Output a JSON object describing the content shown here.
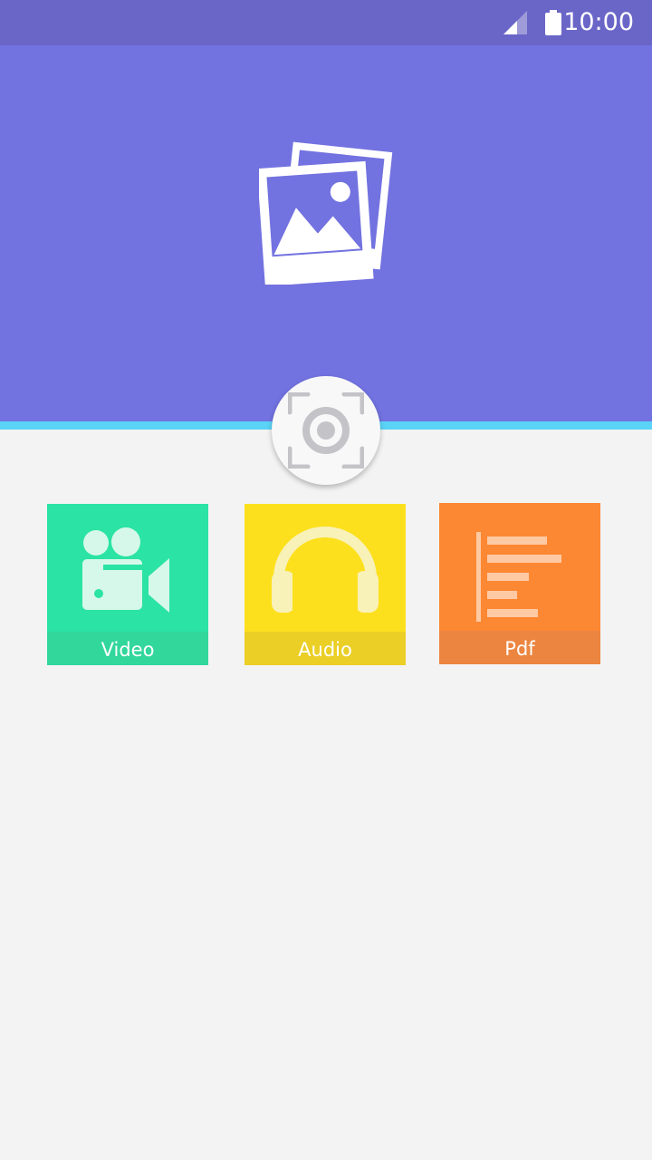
{
  "status_bar": {
    "time": "10:00",
    "icons": [
      "signal-icon",
      "battery-icon"
    ]
  },
  "hero": {
    "icon": "gallery-icon",
    "color": "#7272e0",
    "accent": "#5ad3f6"
  },
  "scan_button": {
    "icon": "scan-icon"
  },
  "tiles": [
    {
      "label": "Video",
      "icon": "video-camera-icon",
      "color": "#2be3a4"
    },
    {
      "label": "Audio",
      "icon": "headphones-icon",
      "color": "#fde01d"
    },
    {
      "label": "Pdf",
      "icon": "document-icon",
      "color": "#fc8833"
    }
  ]
}
